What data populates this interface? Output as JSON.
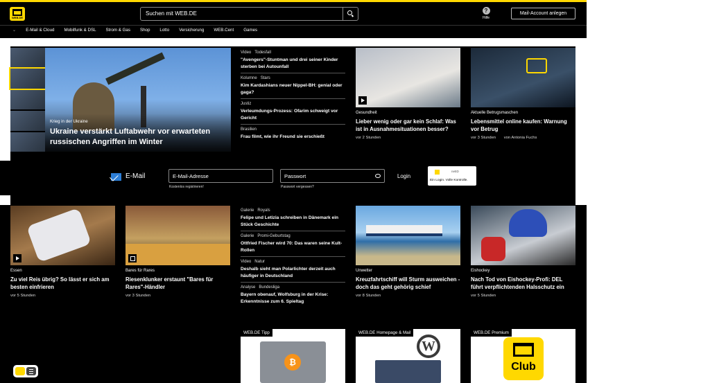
{
  "header": {
    "brand": "WEB.DE",
    "search_placeholder": "Suchen mit WEB.DE",
    "help_label": "Hilfe",
    "account_button": "Mail-Account anlegen"
  },
  "nav": {
    "items": [
      "E-Mail & Cloud",
      "Mobilfunk & DSL",
      "Strom & Gas",
      "Shop",
      "Lotto",
      "Versicherung",
      "WEB.Cent",
      "Games"
    ]
  },
  "hero": {
    "kicker": "Krieg in der Ukraine",
    "title": "Ukraine verstärkt Luftabwehr vor erwarteten russischen Angriffen im Winter"
  },
  "list_top": [
    {
      "tags": [
        "Video",
        "Todesfall"
      ],
      "headline": "\"Avengers\"-Stuntman und drei seiner Kinder sterben bei Autounfall"
    },
    {
      "tags": [
        "Kolumne",
        "Stars"
      ],
      "headline": "Kim Kardashians neuer Nippel-BH: genial oder gaga?"
    },
    {
      "tags": [
        "Justiz"
      ],
      "headline": "Verleumdungs-Prozess: Ofarim schweigt vor Gericht"
    },
    {
      "tags": [
        "Brasilien"
      ],
      "headline": "Frau filmt, wie ihr Freund sie erschießt"
    }
  ],
  "card_sleep": {
    "kicker": "Gesundheit",
    "headline": "Lieber wenig oder gar kein Schlaf: Was ist in Ausnahmesituationen besser?",
    "meta": "vor 2 Stunden"
  },
  "card_fraud": {
    "kicker": "Aktuelle Betrugsmaschen",
    "headline": "Lebensmittel online kaufen: Warnung vor Betrug",
    "meta": "vor 3 Stunden",
    "author": "von Antonia Fuchs"
  },
  "login": {
    "label": "E-Mail",
    "email_placeholder": "E-Mail-Adresse",
    "register_link": "Kostenlos registrieren!",
    "password_placeholder": "Passwort",
    "forgot_link": "Passwort vergessen?",
    "login_button": "Login",
    "netid_brand": "netID",
    "netid_text": "Ein Login. Volle Kontrolle."
  },
  "card_rice": {
    "kicker": "Essen",
    "headline": "Zu viel Reis übrig? So lässt er sich am besten einfrieren",
    "meta": "vor 5 Stunden"
  },
  "card_rares": {
    "kicker": "Bares für Rares",
    "headline": "Riesenklunker erstaunt \"Bares für Rares\"-Händler",
    "meta": "vor 3 Stunden"
  },
  "list_bottom": [
    {
      "tags": [
        "Galerie",
        "Royals"
      ],
      "headline": "Felipe und Letizia schreiben in Dänemark ein Stück Geschichte"
    },
    {
      "tags": [
        "Galerie",
        "Promi-Geburtstag"
      ],
      "headline": "Ottfried Fischer wird 70: Das waren seine Kult-Rollen"
    },
    {
      "tags": [
        "Video",
        "Natur"
      ],
      "headline": "Deshalb sieht man Polarlichter derzeit auch häufiger in Deutschland"
    },
    {
      "tags": [
        "Analyse",
        "Bundesliga"
      ],
      "headline": "Bayern obenauf, Wolfsburg in der Krise: Erkenntnisse zum 6. Spieltag"
    }
  ],
  "card_ship": {
    "kicker": "Unwetter",
    "headline": "Kreuzfahrtschiff will Sturm ausweichen - doch das geht gehörig schief",
    "meta": "vor 8 Stunden"
  },
  "card_hockey": {
    "kicker": "Eishockey",
    "headline": "Nach Tod von Eishockey-Profi: DEL führt verpflichtenden Halsschutz ein",
    "meta": "vor 5 Stunden"
  },
  "promos": [
    {
      "label": "WEB.DE Tipp"
    },
    {
      "label": "WEB.DE Homepage & Mail"
    },
    {
      "label": "WEB.DE Premium",
      "club": "Club"
    }
  ]
}
